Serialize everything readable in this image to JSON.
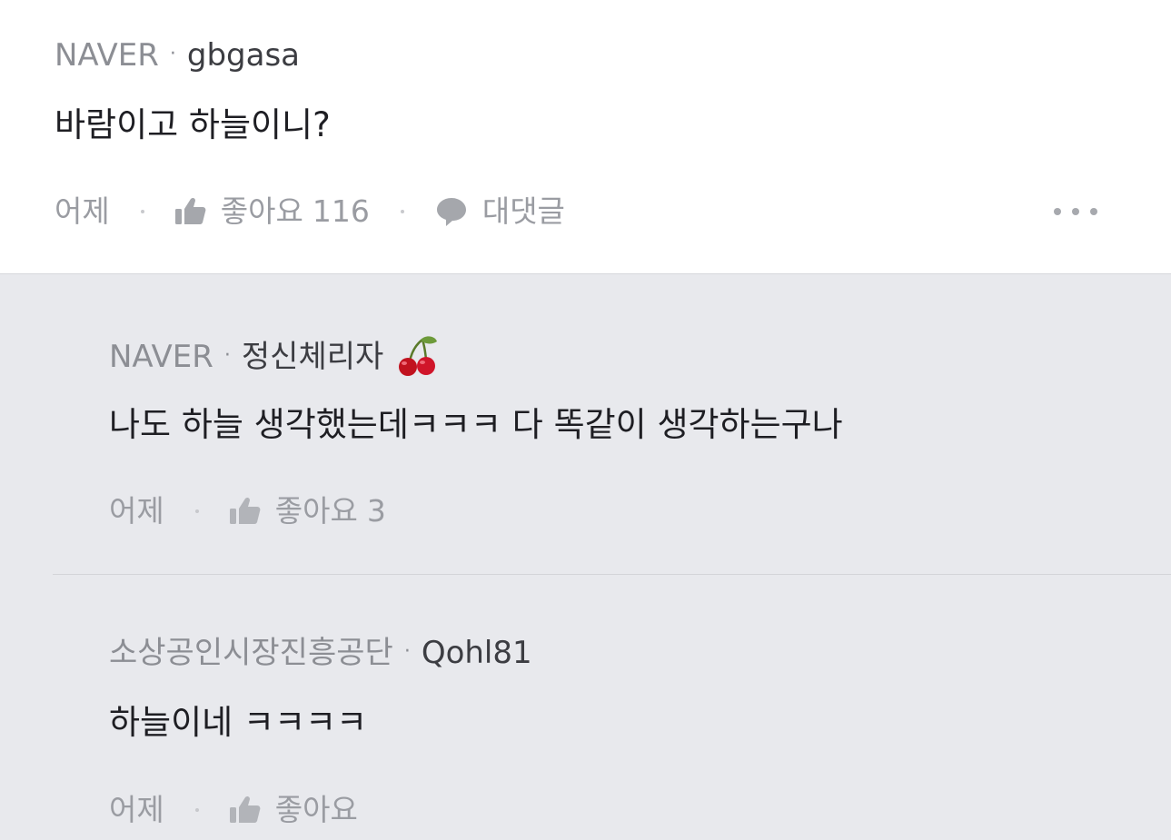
{
  "comments": [
    {
      "source": "NAVER",
      "separator": "·",
      "author": "gbgasa",
      "text": "바람이고 하늘이니?",
      "time": "어제",
      "like_label": "좋아요",
      "like_count": "116",
      "reply_label": "대댓글"
    }
  ],
  "replies": [
    {
      "source": "NAVER",
      "separator": "·",
      "author": "정신체리자",
      "author_emoji": "cherry-icon",
      "text": "나도 하늘 생각했는데ㅋㅋㅋ 다 똑같이 생각하는구나",
      "time": "어제",
      "like_label": "좋아요",
      "like_count": "3"
    },
    {
      "source": "소상공인시장진흥공단",
      "separator": "·",
      "author": "Qohl81",
      "text": "하늘이네 ㅋㅋㅋㅋ",
      "time": "어제",
      "like_label": "좋아요",
      "like_count": ""
    }
  ],
  "colors": {
    "reply_background": "#e8e9ed",
    "muted_text": "#9a9ca2",
    "body_text": "#1e1e23"
  }
}
